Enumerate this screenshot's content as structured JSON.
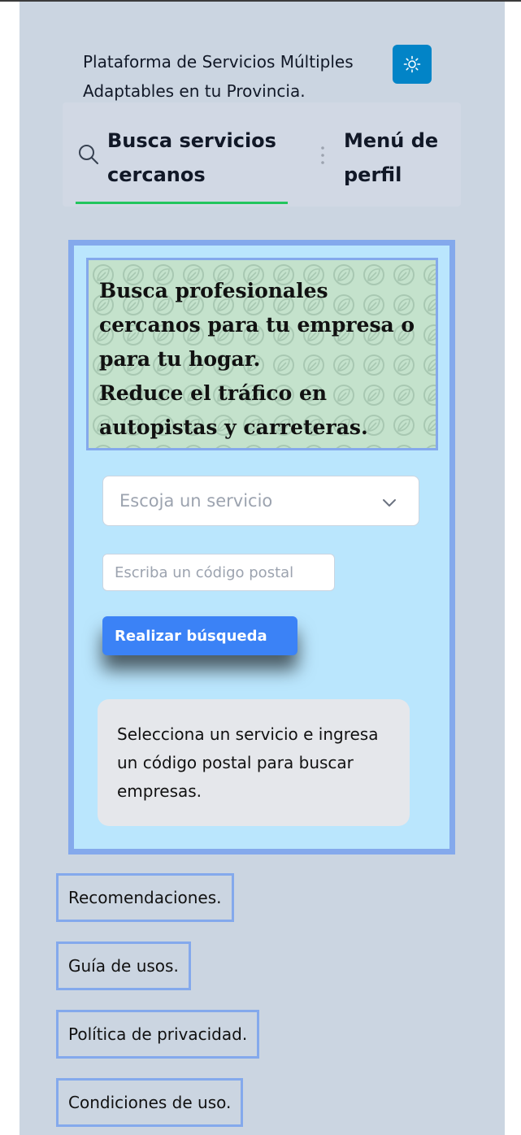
{
  "header": {
    "title": "Plataforma de Servicios Múltiples Adaptables en tu Provincia.",
    "theme_icon": "sun-icon"
  },
  "tabs": [
    {
      "label": "Busca servicios cercanos",
      "icon": "search-icon",
      "active": true
    },
    {
      "label": "Menú de perfil",
      "icon": "",
      "active": false
    }
  ],
  "colors": {
    "page_bg": "#cbd5e1",
    "accent": "#0284c7",
    "active_tab": "#22c55e",
    "card_bg": "#bae6fd",
    "card_border": "#84a9ec",
    "button": "#3b82f6"
  },
  "search": {
    "hero_lines": [
      "Busca profesionales",
      "cercanos para tu empresa o",
      "para tu hogar.",
      "Reduce el tráfico en",
      "autopistas y carreteras."
    ],
    "service_select": {
      "value": "Escoja un servicio"
    },
    "postal_code": {
      "placeholder": "Escriba un código postal",
      "value": ""
    },
    "button_label": "Realizar búsqueda",
    "info_message": "Selecciona un servicio e ingresa un código postal para buscar empresas."
  },
  "footer_links": [
    "Recomendaciones.",
    "Guía de usos.",
    "Política de privacidad.",
    "Condiciones de uso."
  ]
}
